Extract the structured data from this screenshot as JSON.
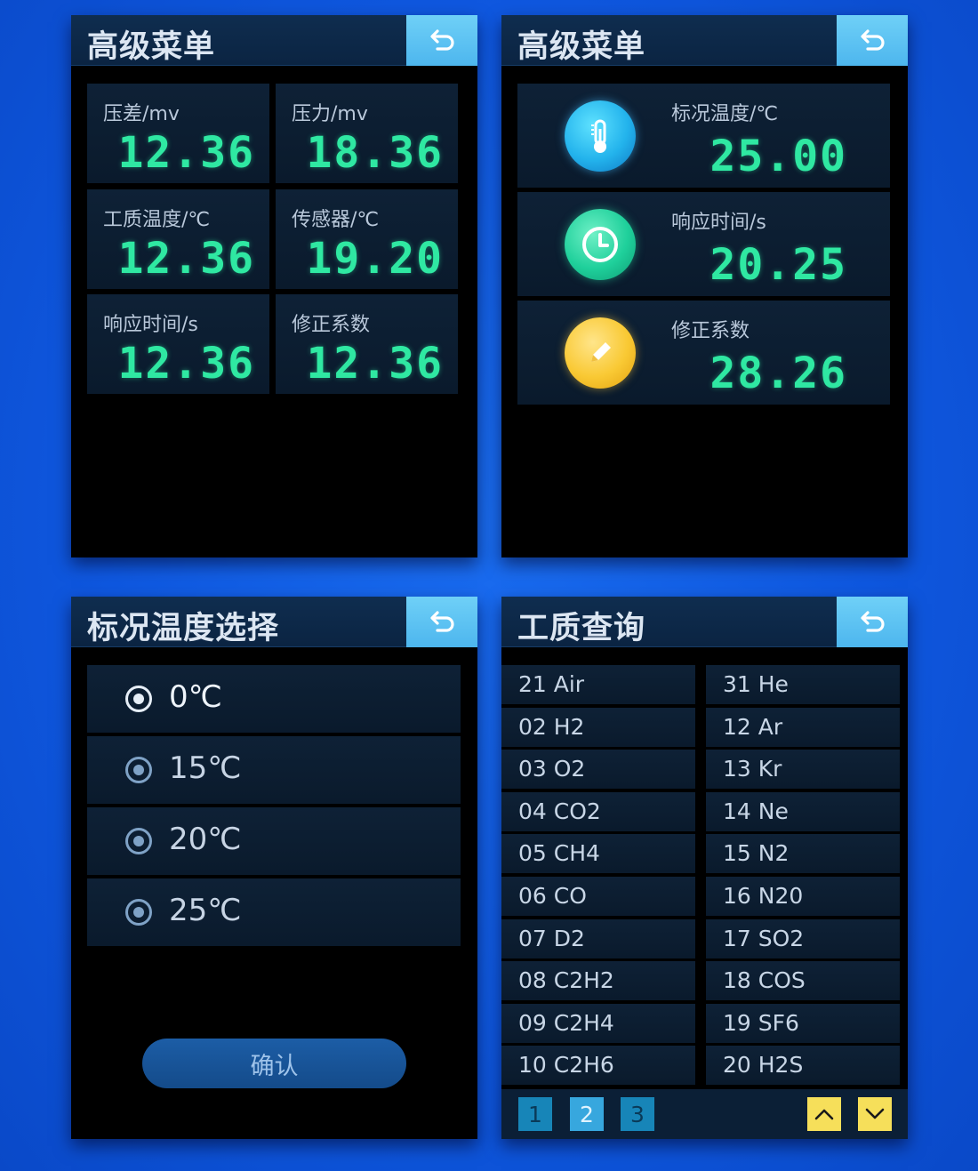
{
  "panels": {
    "measure": {
      "title": "高级菜单",
      "cells": [
        {
          "label": "压差/mv",
          "value": "12.36"
        },
        {
          "label": "压力/mv",
          "value": "18.36"
        },
        {
          "label": "工质温度/℃",
          "value": "12.36"
        },
        {
          "label": "传感器/℃",
          "value": "19.20"
        },
        {
          "label": "响应时间/s",
          "value": "12.36"
        },
        {
          "label": "修正系数",
          "value": "12.36"
        }
      ]
    },
    "settings": {
      "title": "高级菜单",
      "rows": [
        {
          "icon": "thermometer-icon",
          "label": "标况温度/℃",
          "value": "25.00"
        },
        {
          "icon": "clock-icon",
          "label": "响应时间/s",
          "value": "20.25"
        },
        {
          "icon": "pencil-icon",
          "label": "修正系数",
          "value": "28.26"
        }
      ]
    },
    "temp_select": {
      "title": "标况温度选择",
      "options": [
        {
          "label": "0℃",
          "selected": true
        },
        {
          "label": "15℃",
          "selected": false
        },
        {
          "label": "20℃",
          "selected": false
        },
        {
          "label": "25℃",
          "selected": false
        }
      ],
      "confirm_label": "确认"
    },
    "gas_query": {
      "title": "工质查询",
      "left_column": [
        "21  Air",
        "02  H2",
        "03  O2",
        "04  CO2",
        "05  CH4",
        "06  CO",
        "07  D2",
        "08  C2H2",
        "09  C2H4",
        "10  C2H6"
      ],
      "right_column": [
        "31  He",
        "12  Ar",
        "13  Kr",
        "14  Ne",
        "15  N2",
        "16  N20",
        "17  SO2",
        "18  COS",
        "19  SF6",
        "20  H2S"
      ],
      "pages": [
        "1",
        "2",
        "3"
      ],
      "current_page": "2"
    }
  },
  "colors": {
    "digit_green": "#2fe8a2",
    "back_button": "#4db6ee",
    "title_bar": "#0f2d4f",
    "background": "#1a6cf0",
    "page_arrow": "#f6df5a"
  }
}
